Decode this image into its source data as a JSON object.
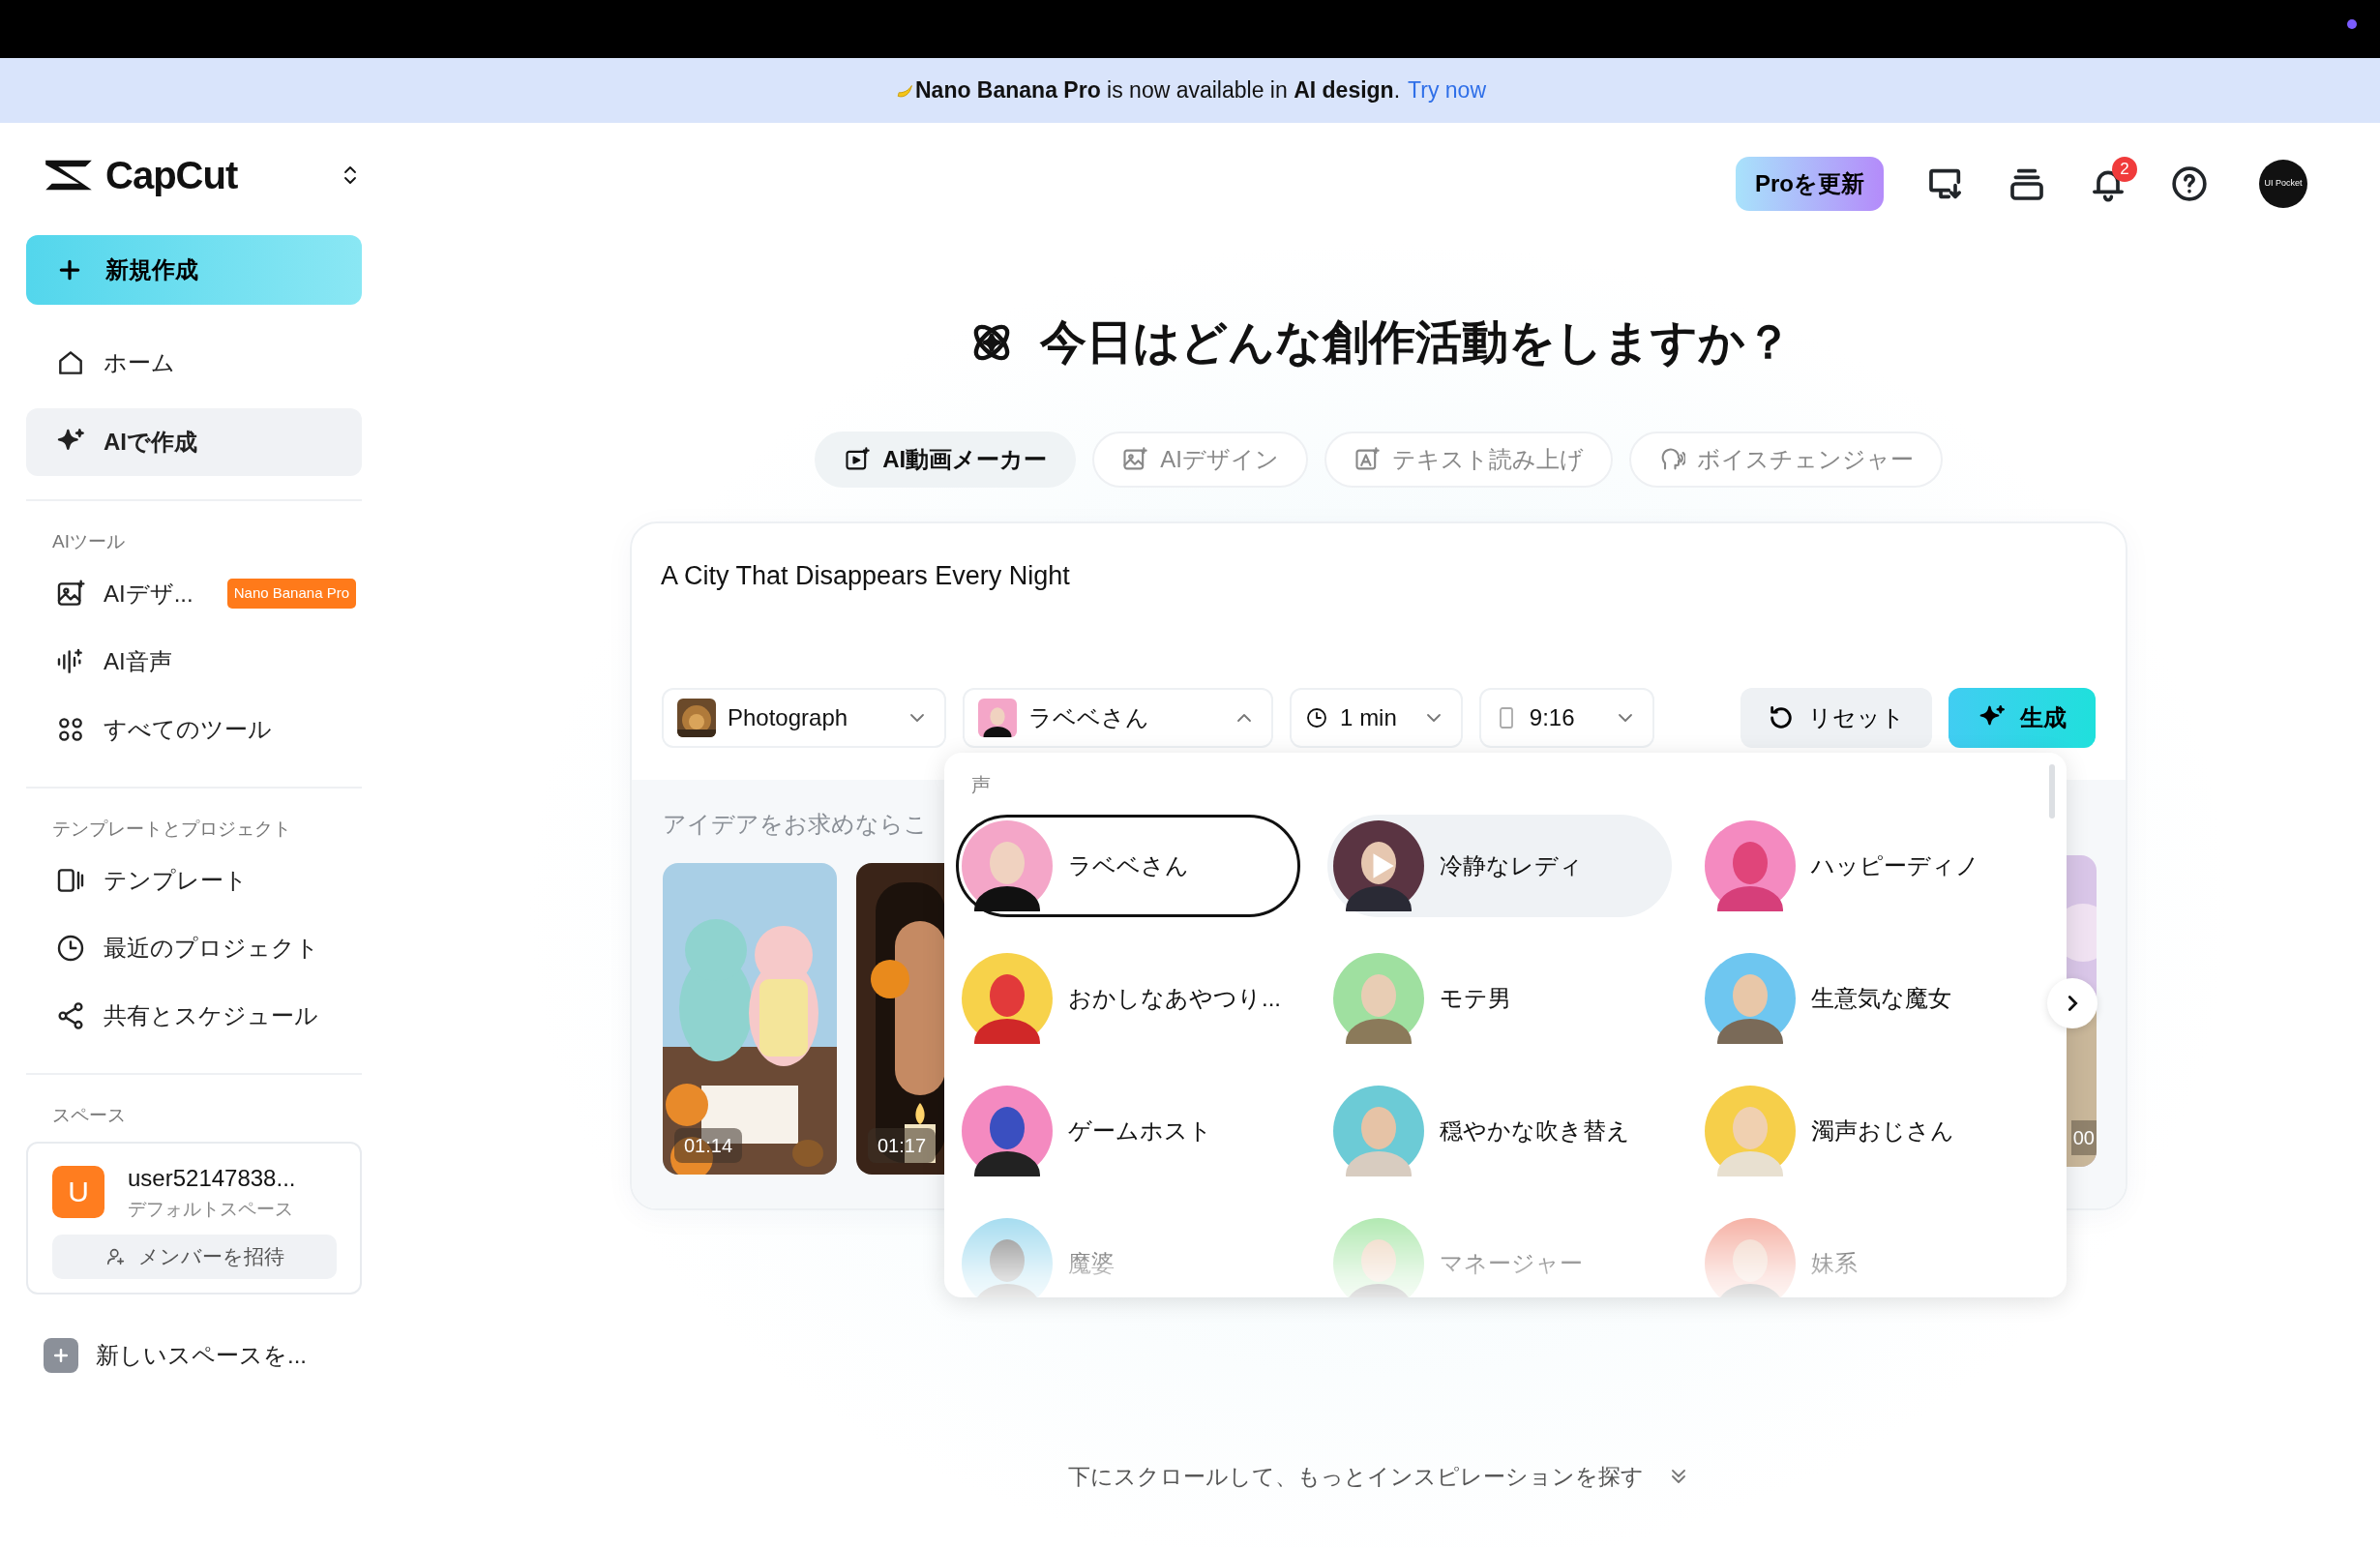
{
  "banner": {
    "message": "**Nano Banana Pro** is now available in **AI design**.",
    "link": "Try now"
  },
  "sidebar": {
    "logo": "CapCut",
    "new_button": "新規作成",
    "nav": [
      {
        "label": "ホーム",
        "selected": false
      },
      {
        "label": "AIで作成",
        "selected": true
      }
    ],
    "sections": [
      {
        "title": "AIツール",
        "items": [
          {
            "label": "AIデザ...",
            "badge": "Nano Banana Pro"
          },
          {
            "label": "AI音声"
          },
          {
            "label": "すべてのツール"
          }
        ]
      },
      {
        "title": "テンプレートとプロジェクト",
        "items": [
          {
            "label": "テンプレート"
          },
          {
            "label": "最近のプロジェクト"
          },
          {
            "label": "共有とスケジュール"
          }
        ]
      }
    ],
    "space": {
      "title": "スペース",
      "avatar": "U",
      "name": "user52147838...",
      "subtitle": "デフォルトスペース",
      "invite": "メンバーを招待"
    },
    "new_space": "新しいスペースを..."
  },
  "header": {
    "upgrade": "Proを更新",
    "notification_count": "2",
    "avatar_label": "UI Pocket"
  },
  "title": "今日はどんな創作活動をしますか？",
  "tabs": [
    {
      "label": "AI動画メーカー",
      "selected": true
    },
    {
      "label": "AIデザイン",
      "selected": false
    },
    {
      "label": "テキスト読み上げ",
      "selected": false
    },
    {
      "label": "ボイスチェンジャー",
      "selected": false
    }
  ],
  "prompt": {
    "value": "A City That Disappears Every Night"
  },
  "options": [
    {
      "kind": "style",
      "label": "Photograph",
      "expanded": false
    },
    {
      "kind": "voice",
      "label": "ラベベさん",
      "expanded": true
    },
    {
      "kind": "duration",
      "label": "1 min",
      "expanded": false
    },
    {
      "kind": "ratio",
      "label": "9:16",
      "expanded": false
    }
  ],
  "actions": {
    "reset": "リセット",
    "generate": "生成"
  },
  "ideas": {
    "label": "アイデアをお求めならこ",
    "videos": [
      {
        "duration": "01:14"
      },
      {
        "duration": "01:17"
      },
      {
        "duration": "00"
      }
    ]
  },
  "voice_menu": {
    "title": "声",
    "voices": [
      {
        "name": "ラベベさん",
        "selected": true,
        "previewing": false
      },
      {
        "name": "冷静なレディ",
        "selected": false,
        "previewing": true
      },
      {
        "name": "ハッピーディノ",
        "selected": false,
        "previewing": false
      },
      {
        "name": "おかしなあやつり...",
        "selected": false,
        "previewing": false
      },
      {
        "name": "モテ男",
        "selected": false,
        "previewing": false
      },
      {
        "name": "生意気な魔女",
        "selected": false,
        "previewing": false
      },
      {
        "name": "ゲームホスト",
        "selected": false,
        "previewing": false
      },
      {
        "name": "穏やかな吹き替え",
        "selected": false,
        "previewing": false
      },
      {
        "name": "濁声おじさん",
        "selected": false,
        "previewing": false
      },
      {
        "name": "魔婆",
        "selected": false,
        "previewing": false
      },
      {
        "name": "マネージャー",
        "selected": false,
        "previewing": false
      },
      {
        "name": "妹系",
        "selected": false,
        "previewing": false
      }
    ]
  },
  "footer_hint": "下にスクロールして、もっとインスピレーションを探す"
}
